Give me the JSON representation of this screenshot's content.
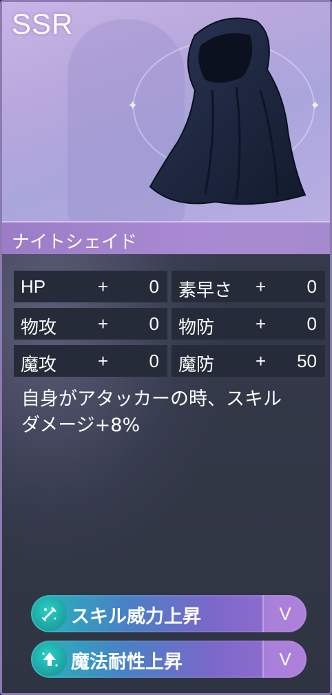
{
  "card": {
    "rarity": "SSR",
    "name": "ナイトシェイド",
    "stats": [
      {
        "label": "HP",
        "sign": "+",
        "value": "0"
      },
      {
        "label": "素早さ",
        "sign": "+",
        "value": "0"
      },
      {
        "label": "物攻",
        "sign": "+",
        "value": "0"
      },
      {
        "label": "物防",
        "sign": "+",
        "value": "0"
      },
      {
        "label": "魔攻",
        "sign": "+",
        "value": "0"
      },
      {
        "label": "魔防",
        "sign": "+",
        "value": "50"
      }
    ],
    "description_line1": "自身がアタッカーの時、スキル",
    "description_line2": "ダメージ+8%",
    "skills": [
      {
        "label": "スキル威力上昇",
        "icon": "sword-sparkle-icon",
        "toggle": "V"
      },
      {
        "label": "魔法耐性上昇",
        "icon": "arrow-up-sparkle-icon",
        "toggle": "V"
      }
    ]
  },
  "colors": {
    "rarity_bg": "#b9a7de",
    "name_bar": "#a68acf",
    "panel": "#353a4a",
    "stat_cell": "#262b3a",
    "skill_start": "#22b9b9",
    "skill_end": "#9b6fd2"
  }
}
